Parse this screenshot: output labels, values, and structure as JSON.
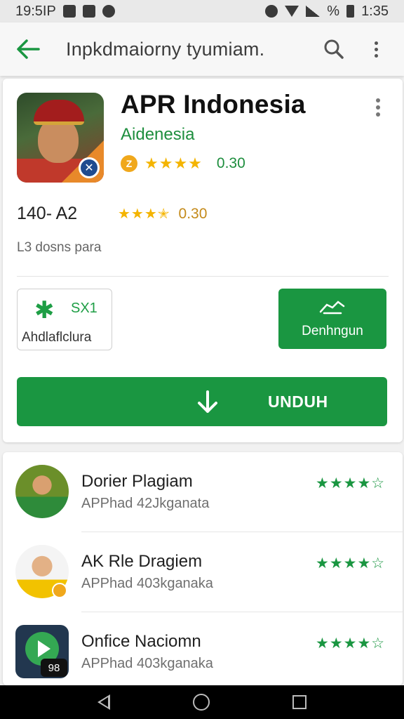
{
  "status_bar": {
    "time_left": "19:5IP",
    "percent": "%",
    "time_right": "1:35"
  },
  "app_bar": {
    "title": "Inpkdmaiorny tyumiam."
  },
  "app": {
    "name": "APR Indonesia",
    "developer": "Aidenesia",
    "coin_label": "Z",
    "stars": "★★★★",
    "rating": "0.30",
    "size": "140- A2",
    "size_stars": "★★★✭",
    "size_rating": "0.30",
    "note": "L3 dosns para"
  },
  "actions": {
    "outline_code": "SX1",
    "outline_label": "Ahdlaflclura",
    "green_label": "Denhngun",
    "download_label": "UNDUH"
  },
  "list": [
    {
      "title": "Dorier Plagiam",
      "subtitle": "APPhad 42Jkganata",
      "stars": "★★★★☆"
    },
    {
      "title": "AK Rle Dragiem",
      "subtitle": "APPhad 403kganaka",
      "stars": "★★★★☆"
    },
    {
      "title": "Onfice Naciomn",
      "subtitle": "APPhad 403kganaka",
      "stars": "★★★★☆"
    }
  ],
  "list_tag": "98",
  "colors": {
    "primary_green": "#1a9641",
    "star_yellow": "#f4b400"
  }
}
